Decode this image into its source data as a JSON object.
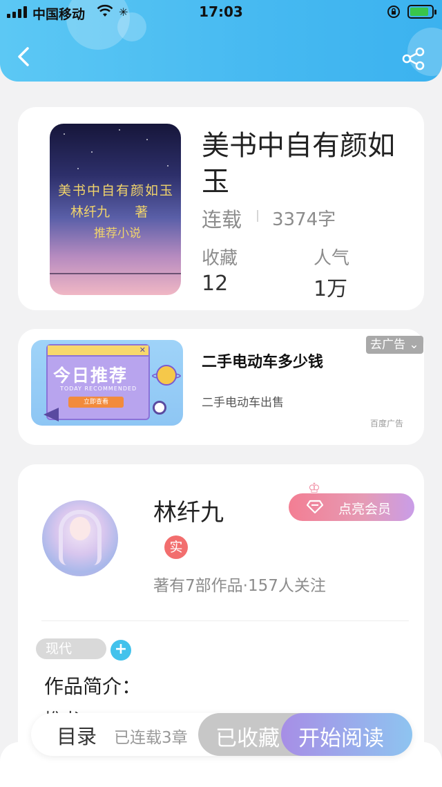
{
  "status_bar": {
    "carrier": "中国移动",
    "time": "17:03"
  },
  "header": {
    "back_icon": "chevron-left-icon",
    "share_icon": "share-icon",
    "accent_color": "#46b9f1"
  },
  "book": {
    "title": "美书中自有颜如玉",
    "cover_lines": [
      "美书中自有颜如玉",
      "林纤九      著",
      "推荐小说"
    ],
    "status": "连载",
    "word_count": "3374字",
    "stats": [
      {
        "label": "收藏",
        "value": "12"
      },
      {
        "label": "人气",
        "value": "1万"
      }
    ]
  },
  "ad": {
    "image_headline": "今日推荐",
    "image_subline": "TODAY RECOMMENDED",
    "image_button": "立即查看",
    "title": "二手电动车多少钱",
    "subtitle": "二手电动车出售",
    "tag": "去广告 ⌄",
    "source": "百度广告"
  },
  "author": {
    "name": "林纤九",
    "vip_label": "点亮会员",
    "verified_badge": "实",
    "meta": "著有7部作品·157人关注",
    "tags": [
      "现代"
    ],
    "add_tag": "+",
    "intro_label": "作品简介：",
    "intro_text": "推书"
  },
  "bottom_bar": {
    "toc_label": "目录",
    "progress": "已连载3章",
    "favorite_label": "已收藏",
    "read_label": "开始阅读"
  }
}
